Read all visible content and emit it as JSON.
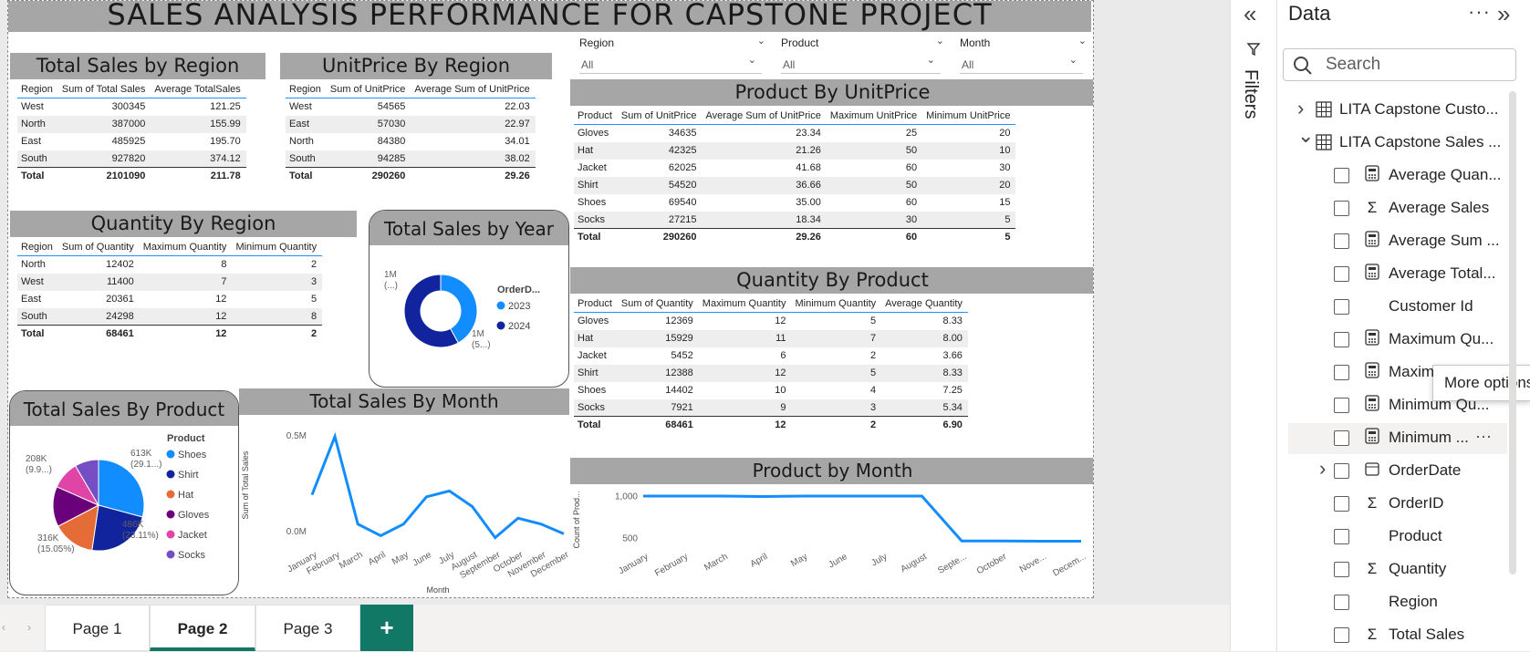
{
  "title": "SALES ANALYSIS PERFORMANCE FOR CAPSTONE PROJECT",
  "slicers": [
    {
      "label": "Region",
      "value": "All"
    },
    {
      "label": "Product",
      "value": "All"
    },
    {
      "label": "Month",
      "value": "All"
    }
  ],
  "sales_region": {
    "title": "Total Sales by Region",
    "headers": [
      "Region",
      "Sum of Total Sales",
      "Average TotalSales"
    ],
    "rows": [
      [
        "West",
        "300345",
        "121.25"
      ],
      [
        "North",
        "387000",
        "155.99"
      ],
      [
        "East",
        "485925",
        "195.70"
      ],
      [
        "South",
        "927820",
        "374.12"
      ]
    ],
    "total": [
      "Total",
      "2101090",
      "211.78"
    ]
  },
  "unitprice_region": {
    "title": "UnitPrice By Region",
    "headers": [
      "Region",
      "Sum of UnitPrice",
      "Average Sum of UnitPrice"
    ],
    "rows": [
      [
        "West",
        "54565",
        "22.03"
      ],
      [
        "East",
        "57030",
        "22.97"
      ],
      [
        "North",
        "84380",
        "34.01"
      ],
      [
        "South",
        "94285",
        "38.02"
      ]
    ],
    "total": [
      "Total",
      "290260",
      "29.26"
    ]
  },
  "quantity_region": {
    "title": "Quantity By Region",
    "headers": [
      "Region",
      "Sum of Quantity",
      "Maximum Quantity",
      "Minimum Quantity"
    ],
    "rows": [
      [
        "North",
        "12402",
        "8",
        "2"
      ],
      [
        "West",
        "11400",
        "7",
        "3"
      ],
      [
        "East",
        "20361",
        "12",
        "5"
      ],
      [
        "South",
        "24298",
        "12",
        "8"
      ]
    ],
    "total": [
      "Total",
      "68461",
      "12",
      "2"
    ]
  },
  "product_unitprice": {
    "title": "Product By UnitPrice",
    "headers": [
      "Product",
      "Sum of UnitPrice",
      "Average Sum of UnitPrice",
      "Maximum UnitPrice",
      "Minimum UnitPrice"
    ],
    "rows": [
      [
        "Gloves",
        "34635",
        "23.34",
        "25",
        "20"
      ],
      [
        "Hat",
        "42325",
        "21.26",
        "50",
        "10"
      ],
      [
        "Jacket",
        "62025",
        "41.68",
        "60",
        "30"
      ],
      [
        "Shirt",
        "54520",
        "36.66",
        "50",
        "20"
      ],
      [
        "Shoes",
        "69540",
        "35.00",
        "60",
        "15"
      ],
      [
        "Socks",
        "27215",
        "18.34",
        "30",
        "5"
      ]
    ],
    "total": [
      "Total",
      "290260",
      "29.26",
      "60",
      "5"
    ]
  },
  "quantity_product": {
    "title": "Quantity By Product",
    "headers": [
      "Product",
      "Sum of Quantity",
      "Maximum Quantity",
      "Minimum Quantity",
      "Average Quantity"
    ],
    "rows": [
      [
        "Gloves",
        "12369",
        "12",
        "5",
        "8.33"
      ],
      [
        "Hat",
        "15929",
        "11",
        "7",
        "8.00"
      ],
      [
        "Jacket",
        "5452",
        "6",
        "2",
        "3.66"
      ],
      [
        "Shirt",
        "12388",
        "12",
        "5",
        "8.33"
      ],
      [
        "Shoes",
        "14402",
        "10",
        "4",
        "7.25"
      ],
      [
        "Socks",
        "7921",
        "9",
        "3",
        "5.34"
      ]
    ],
    "total": [
      "Total",
      "68461",
      "12",
      "2",
      "6.90"
    ]
  },
  "chart_data": [
    {
      "type": "pie",
      "title": "Total Sales by Year",
      "donut": true,
      "legend_title": "OrderD...",
      "labels": [
        "2023",
        "2024"
      ],
      "colors": [
        "#118dff",
        "#12239e"
      ],
      "values": [
        0.42,
        0.58
      ],
      "data_labels": [
        "1M\n(...)",
        "1M\n(5...)"
      ]
    },
    {
      "type": "pie",
      "title": "Total Sales By Product",
      "legend_title": "Product",
      "labels": [
        "Shoes",
        "Shirt",
        "Hat",
        "Gloves",
        "Jacket",
        "Socks"
      ],
      "colors": [
        "#118dff",
        "#12239e",
        "#e66c37",
        "#6b007b",
        "#e044a7",
        "#744ec2"
      ],
      "values": [
        613,
        486,
        316,
        300,
        208,
        178
      ],
      "data_labels": [
        "613K\n(29.1...)",
        "486K\n(23.11%)",
        "316K\n(15.05%)",
        "",
        "208K\n(9.9...)",
        ""
      ]
    },
    {
      "type": "line",
      "title": "Total Sales By Month",
      "xlabel": "Month",
      "ylabel": "Sum of Total Sales",
      "yticks": [
        "0.5M",
        "0.0M"
      ],
      "ylim": [
        0,
        0.6
      ],
      "categories": [
        "January",
        "February",
        "March",
        "April",
        "May",
        "June",
        "July",
        "August",
        "September",
        "October",
        "November",
        "December"
      ],
      "values": [
        0.25,
        0.55,
        0.1,
        0.04,
        0.1,
        0.24,
        0.27,
        0.19,
        0.03,
        0.13,
        0.1,
        0.05
      ],
      "color": "#118dff"
    },
    {
      "type": "line",
      "title": "Product by Month",
      "xlabel": "",
      "ylabel": "Count of Prod...",
      "yticks": [
        "1,000",
        "500"
      ],
      "ylim": [
        450,
        1020
      ],
      "categories": [
        "January",
        "February",
        "March",
        "April",
        "May",
        "June",
        "July",
        "August",
        "Septe...",
        "October",
        "Nove...",
        "Decem..."
      ],
      "values": [
        1000,
        1000,
        1000,
        995,
        1000,
        1000,
        1000,
        1000,
        498,
        498,
        496,
        496
      ],
      "color": "#118dff"
    }
  ],
  "tabs": [
    "Page 1",
    "Page 2",
    "Page 3"
  ],
  "add_tab": "+",
  "filters_label": "Filters",
  "data_pane": {
    "title": "Data",
    "search_placeholder": "Search",
    "tooltip": "More options",
    "tables": [
      "LITA Capstone Custo...",
      "LITA Capstone Sales ..."
    ],
    "fields": [
      {
        "label": "Average Quan...",
        "icon": "calc"
      },
      {
        "label": "Average Sales",
        "icon": "sigma"
      },
      {
        "label": "Average Sum ...",
        "icon": "calc"
      },
      {
        "label": "Average Total...",
        "icon": "calc"
      },
      {
        "label": "Customer Id",
        "icon": ""
      },
      {
        "label": "Maximum Qu...",
        "icon": "calc"
      },
      {
        "label": "Maxim",
        "icon": "calc"
      },
      {
        "label": "Minimum Qu...",
        "icon": "calc"
      },
      {
        "label": "Minimum ...",
        "icon": "calc"
      },
      {
        "label": "OrderDate",
        "icon": "calendar"
      },
      {
        "label": "OrderID",
        "icon": "sigma"
      },
      {
        "label": "Product",
        "icon": ""
      },
      {
        "label": "Quantity",
        "icon": "sigma"
      },
      {
        "label": "Region",
        "icon": ""
      },
      {
        "label": "Total Sales",
        "icon": "sigma"
      }
    ]
  }
}
